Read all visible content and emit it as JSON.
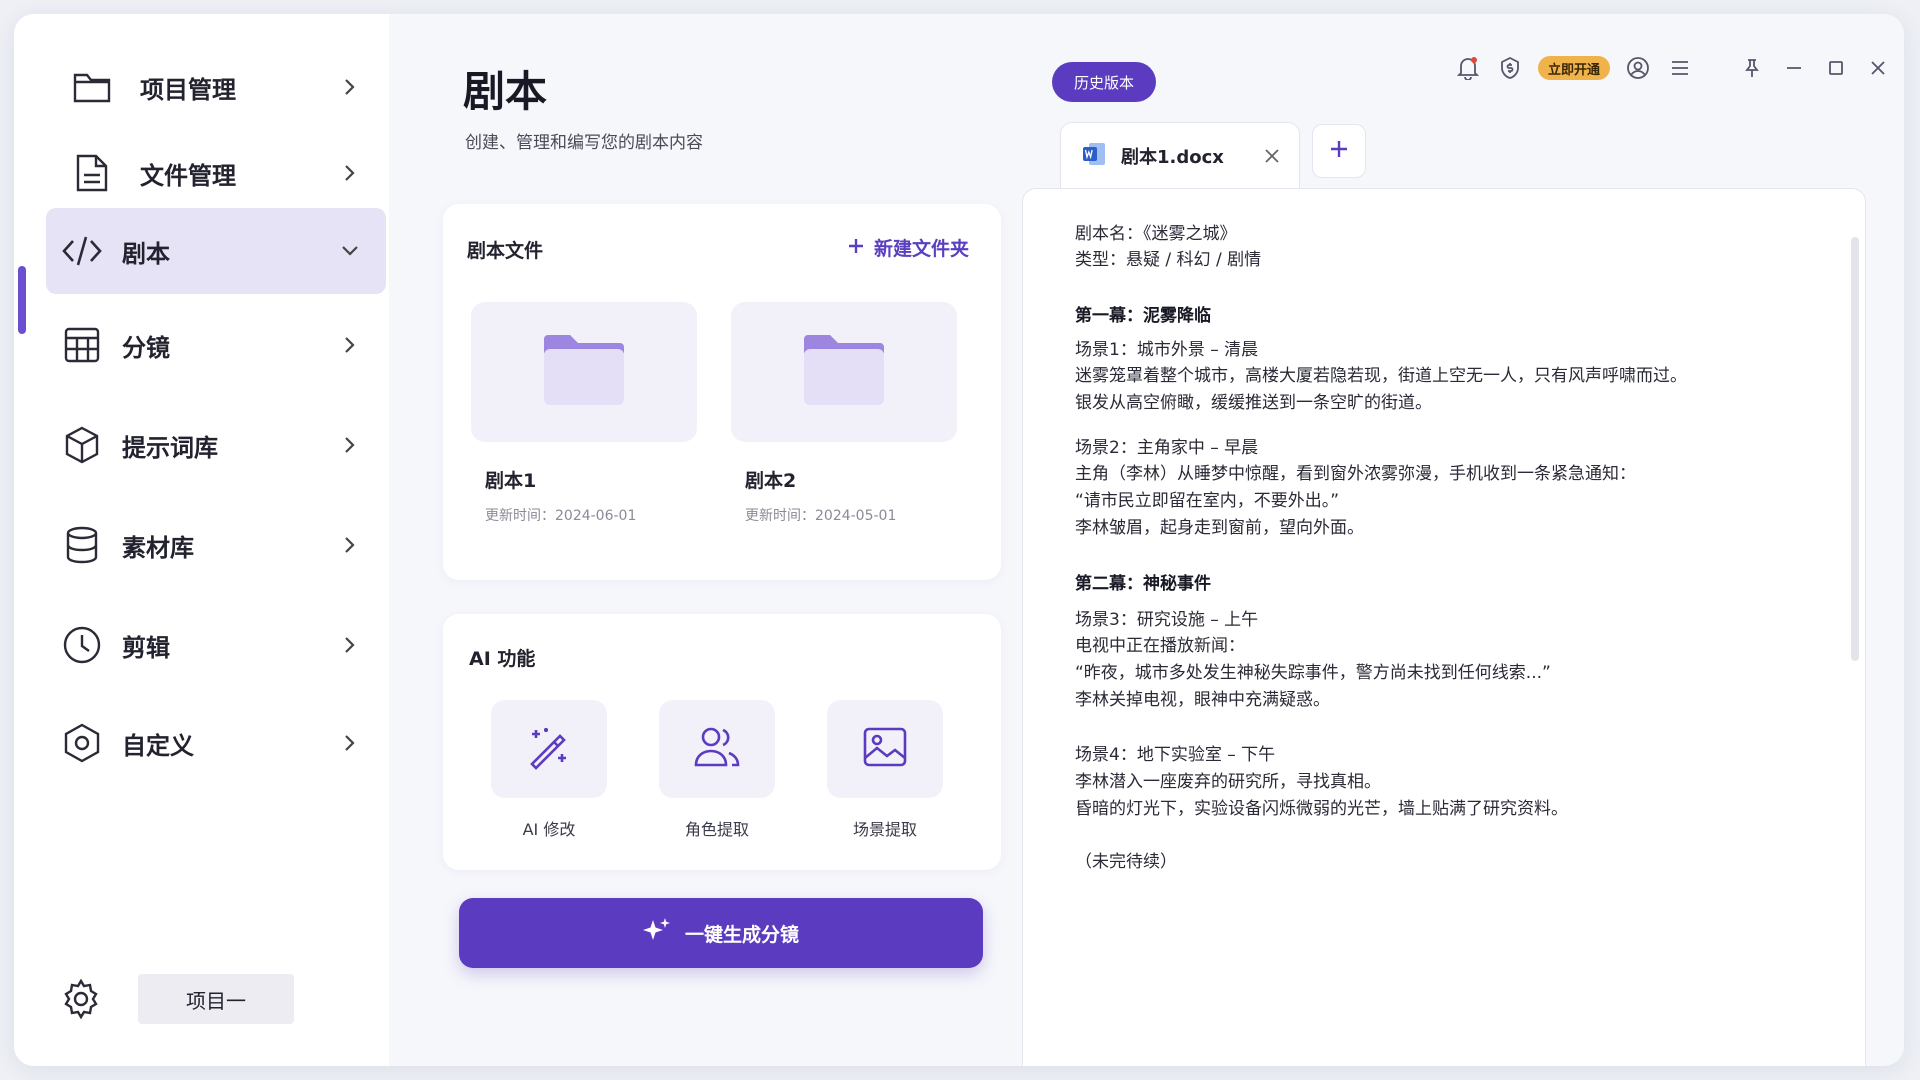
{
  "sidebar": {
    "items": [
      {
        "label": "项目管理",
        "icon": "folder-icon"
      },
      {
        "label": "文件管理",
        "icon": "file-icon"
      },
      {
        "label": "剧本",
        "icon": "code-icon",
        "active": true
      },
      {
        "label": "分镜",
        "icon": "grid-icon"
      },
      {
        "label": "提示词库",
        "icon": "cube-icon"
      },
      {
        "label": "素材库",
        "icon": "database-icon"
      },
      {
        "label": "剪辑",
        "icon": "clock-icon"
      },
      {
        "label": "自定义",
        "icon": "hexagon-icon"
      }
    ],
    "project": "项目一"
  },
  "header": {
    "title": "剧本",
    "subtitle": "创建、管理和编写您的剧本内容"
  },
  "scripts_card": {
    "title": "剧本文件",
    "new_folder": "新建文件夹",
    "folders": [
      {
        "name": "剧本1",
        "date": "更新时间：2024-06-01"
      },
      {
        "name": "剧本2",
        "date": "更新时间：2024-05-01"
      }
    ]
  },
  "ai_card": {
    "title": "AI 功能",
    "tools": [
      {
        "label": "AI 修改",
        "icon": "magic-wand-icon"
      },
      {
        "label": "角色提取",
        "icon": "users-icon"
      },
      {
        "label": "场景提取",
        "icon": "image-icon"
      }
    ]
  },
  "generate_button": "一键生成分镜",
  "history_button": "历史版本",
  "topbar": {
    "vip": "立即开通"
  },
  "tab": {
    "label": "剧本1.docx"
  },
  "document": {
    "lines": [
      {
        "text": "剧本名：《迷雾之城》",
        "bold": false
      },
      {
        "text": "类型：悬疑 / 科幻 / 剧情",
        "bold": false
      },
      {
        "text": "第一幕：泥雾降临",
        "bold": true
      },
      {
        "text": "场景1：城市外景 – 清晨",
        "bold": false
      },
      {
        "text": "迷雾笼罩着整个城市，高楼大厦若隐若现，街道上空无一人，只有风声呼啸而过。",
        "bold": false
      },
      {
        "text": "银发从高空俯瞰，缓缓推送到一条空旷的街道。",
        "bold": false
      },
      {
        "text": "场景2：主角家中 – 早晨",
        "bold": false
      },
      {
        "text": "主角（李林）从睡梦中惊醒，看到窗外浓雾弥漫，手机收到一条紧急通知：",
        "bold": false
      },
      {
        "text": "“请市民立即留在室内，不要外出。”",
        "bold": false
      },
      {
        "text": "李林皱眉，起身走到窗前，望向外面。",
        "bold": false
      },
      {
        "text": "第二幕：神秘事件",
        "bold": true
      },
      {
        "text": "场景3：研究设施 – 上午",
        "bold": false
      },
      {
        "text": "电视中正在播放新闻：",
        "bold": false
      },
      {
        "text": "“昨夜，城市多处发生神秘失踪事件，警方尚未找到任何线索...”",
        "bold": false
      },
      {
        "text": "李林关掉电视，眼神中充满疑惑。",
        "bold": false
      },
      {
        "text": "场景4：地下实验室 – 下午",
        "bold": false
      },
      {
        "text": "李林潜入一座废弃的研究所，寻找真相。",
        "bold": false
      },
      {
        "text": "昏暗的灯光下，实验设备闪烁微弱的光芒，墙上贴满了研究资料。",
        "bold": false
      },
      {
        "text": "（未完待续）",
        "bold": false
      }
    ]
  },
  "colors": {
    "accent": "#5b3cc0",
    "active_bg": "#e6e3f6",
    "vip": "#f0b24a"
  }
}
